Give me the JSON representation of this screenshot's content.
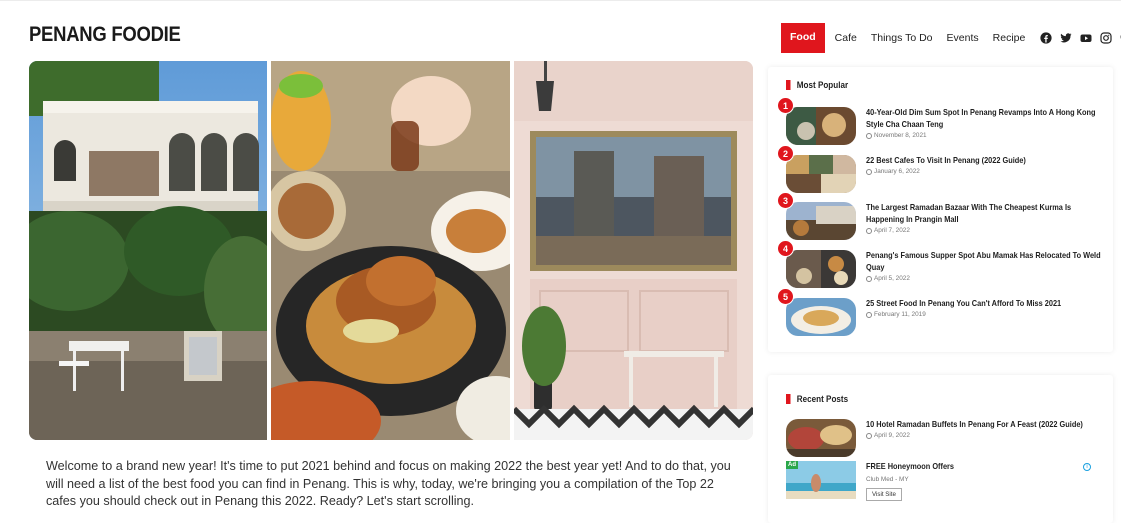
{
  "site": {
    "logo": "PENANG FOODIE"
  },
  "nav": {
    "items": [
      {
        "label": "Food",
        "active": true
      },
      {
        "label": "Cafe",
        "active": false
      },
      {
        "label": "Things To Do",
        "active": false
      },
      {
        "label": "Events",
        "active": false
      },
      {
        "label": "Recipe",
        "active": false
      }
    ],
    "icons": [
      "facebook-icon",
      "twitter-icon",
      "youtube-icon",
      "instagram-icon",
      "search-icon"
    ]
  },
  "article": {
    "intro": "Welcome to a brand new year! It's time to put 2021 behind and focus on making 2022 the best year yet! And to do that, you will need a list of the best food you can find in Penang. This is why, today, we're bringing you a compilation of the Top 22 cafes you should check out in Penang this 2022. Ready? Let's start scrolling."
  },
  "sidebar": {
    "most_popular": {
      "title": "Most Popular",
      "items": [
        {
          "rank": "1",
          "title": "40-Year-Old Dim Sum Spot In Penang Revamps Into A Hong Kong Style Cha Chaan Teng",
          "date": "November 8, 2021"
        },
        {
          "rank": "2",
          "title": "22 Best Cafes To Visit In Penang (2022 Guide)",
          "date": "January 6, 2022"
        },
        {
          "rank": "3",
          "title": "The Largest Ramadan Bazaar With The Cheapest Kurma Is Happening In Prangin Mall",
          "date": "April 7, 2022"
        },
        {
          "rank": "4",
          "title": "Penang's Famous Supper Spot Abu Mamak Has Relocated To Weld Quay",
          "date": "April 5, 2022"
        },
        {
          "rank": "5",
          "title": "25 Street Food In Penang You Can't Afford To Miss 2021",
          "date": "February 11, 2019"
        }
      ]
    },
    "recent_posts": {
      "title": "Recent Posts",
      "items": [
        {
          "title": "10 Hotel Ramadan Buffets In Penang For A Feast (2022 Guide)",
          "date": "April 9, 2022"
        }
      ],
      "ad": {
        "badge": "Ad",
        "title": "FREE Honeymoon Offers",
        "advertiser": "Club Med - MY",
        "button": "Visit Site"
      }
    }
  },
  "colors": {
    "accent": "#e0161d",
    "text": "#222222",
    "muted": "#777777"
  }
}
